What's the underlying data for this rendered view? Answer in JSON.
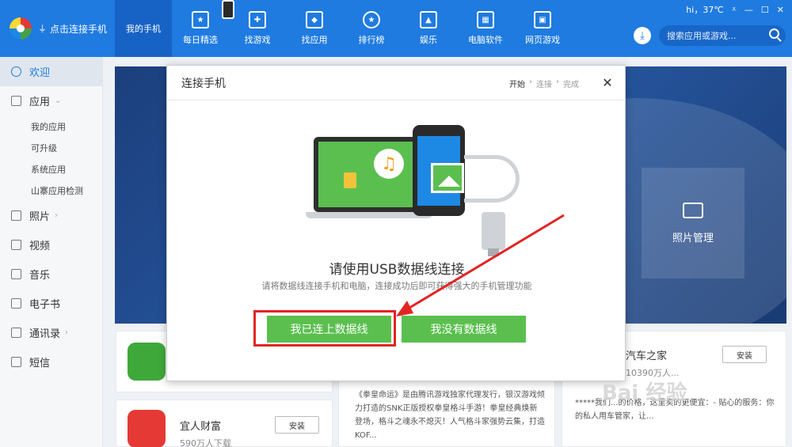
{
  "header": {
    "connect_label": "点击连接手机",
    "nav": [
      {
        "label": "我的手机",
        "icon": "phone-icon",
        "active": true
      },
      {
        "label": "每日精选",
        "icon": "calendar-star-icon"
      },
      {
        "label": "找游戏",
        "icon": "gamepad-icon"
      },
      {
        "label": "找应用",
        "icon": "shopping-bag-icon"
      },
      {
        "label": "排行榜",
        "icon": "medal-icon"
      },
      {
        "label": "娱乐",
        "icon": "entertainment-icon"
      },
      {
        "label": "电脑软件",
        "icon": "monitor-icon"
      },
      {
        "label": "网页游戏",
        "icon": "browser-game-icon"
      }
    ],
    "weather": "hi，37℃",
    "search_placeholder": "搜索应用或游戏..."
  },
  "sidebar": {
    "items": [
      {
        "label": "欢迎",
        "icon": "welcome-icon",
        "active": true
      },
      {
        "label": "应用",
        "icon": "apps-grid-icon",
        "expandable": true
      },
      {
        "label": "我的应用",
        "sub": true
      },
      {
        "label": "可升级",
        "sub": true
      },
      {
        "label": "系统应用",
        "sub": true
      },
      {
        "label": "山寨应用检测",
        "sub": true
      },
      {
        "label": "照片",
        "icon": "photo-icon",
        "expandable": true
      },
      {
        "label": "视频",
        "icon": "video-icon"
      },
      {
        "label": "音乐",
        "icon": "music-icon"
      },
      {
        "label": "电子书",
        "icon": "ebook-icon"
      },
      {
        "label": "通讯录",
        "icon": "contacts-icon",
        "expandable": true
      },
      {
        "label": "短信",
        "icon": "sms-icon"
      }
    ]
  },
  "background": {
    "photo_tile_label": "照片管理",
    "cards": {
      "car_home": {
        "name": "汽车之家",
        "downloads": "10390万人...",
        "install": "安装"
      },
      "yiren": {
        "name": "宜人财富",
        "downloads": "590万人下载",
        "install": "安装"
      },
      "game_desc": "《拳皇命运》是由腾讯游戏独家代理发行，银汉游戏倾力打造的SNK正版授权拳皇格斗手游！拳皇经典焕新登场，格斗之魂永不熄灭！人气格斗家强势云集，打造KOF...",
      "car_desc": "*****我们...的价格，这里卖的更便宜：- 贴心的服务：你的私人用车管家，让... "
    }
  },
  "modal": {
    "title": "连接手机",
    "steps": [
      "开始",
      "连接",
      "完成"
    ],
    "headline": "请使用USB数据线连接",
    "subline": "请将数据线连接手机和电脑，连接成功后即可获得强大的手机管理功能",
    "btn_connected": "我已连上数据线",
    "btn_no_cable": "我没有数据线"
  },
  "watermark": "Bai 经验",
  "colors": {
    "brand": "#1f7be0",
    "green": "#5bbf4f",
    "highlight": "#e32424"
  }
}
